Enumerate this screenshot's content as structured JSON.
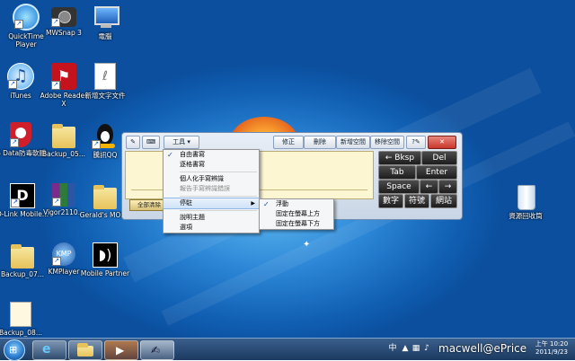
{
  "desktop": {
    "icons": [
      {
        "label": "QuickTime Player"
      },
      {
        "label": "MWSnap 3"
      },
      {
        "label": "電腦"
      },
      {
        "label": "iTunes"
      },
      {
        "label": "Adobe Reader X"
      },
      {
        "label": "新增文字文件"
      },
      {
        "label": "G Data防毒軟體"
      },
      {
        "label": "Backup_05..."
      },
      {
        "label": "騰訊QQ"
      },
      {
        "label": "D-Link Mobile..."
      },
      {
        "label": "Vigor2110..."
      },
      {
        "label": "Gerald's MOBO"
      },
      {
        "label": "Backup_07..."
      },
      {
        "label": "KMPlayer"
      },
      {
        "label": "Mobile Partner"
      },
      {
        "label": "Backup_08..."
      },
      {
        "label": "資源回收筒"
      }
    ]
  },
  "input_panel": {
    "tools_button": "工具",
    "toolbar_buttons": [
      "修正",
      "刪除",
      "新增空間",
      "移除空間"
    ],
    "clear_all": "全部清除",
    "keys": {
      "backspace": "← Bksp",
      "delete": "Del",
      "tab": "Tab",
      "enter": "Enter",
      "space": "Space",
      "left": "←",
      "right": "→",
      "numbers": "數字",
      "symbols": "符號",
      "web": "網站"
    }
  },
  "tools_menu": {
    "items": [
      {
        "label": "自由書寫",
        "checked": true
      },
      {
        "label": "逐格書寫"
      },
      {
        "label": "個人化手寫辨識"
      },
      {
        "label": "報告手寫辨識錯誤",
        "disabled": true
      },
      {
        "label": "停駐",
        "submenu": true
      },
      {
        "label": "說明主題"
      },
      {
        "label": "選項"
      }
    ]
  },
  "dock_submenu": {
    "items": [
      {
        "label": "浮動",
        "checked": true
      },
      {
        "label": "固定在螢幕上方"
      },
      {
        "label": "固定在螢幕下方"
      }
    ]
  },
  "taskbar": {
    "clock_time": "上午 10:20",
    "clock_date": "2011/9/23",
    "language_indicator": "中",
    "watermark": "macwell@ePrice"
  },
  "colors": {
    "desktop_blue": "#1a6cc4",
    "write_area": "#fdf6d3",
    "close_button": "#c9372c"
  }
}
